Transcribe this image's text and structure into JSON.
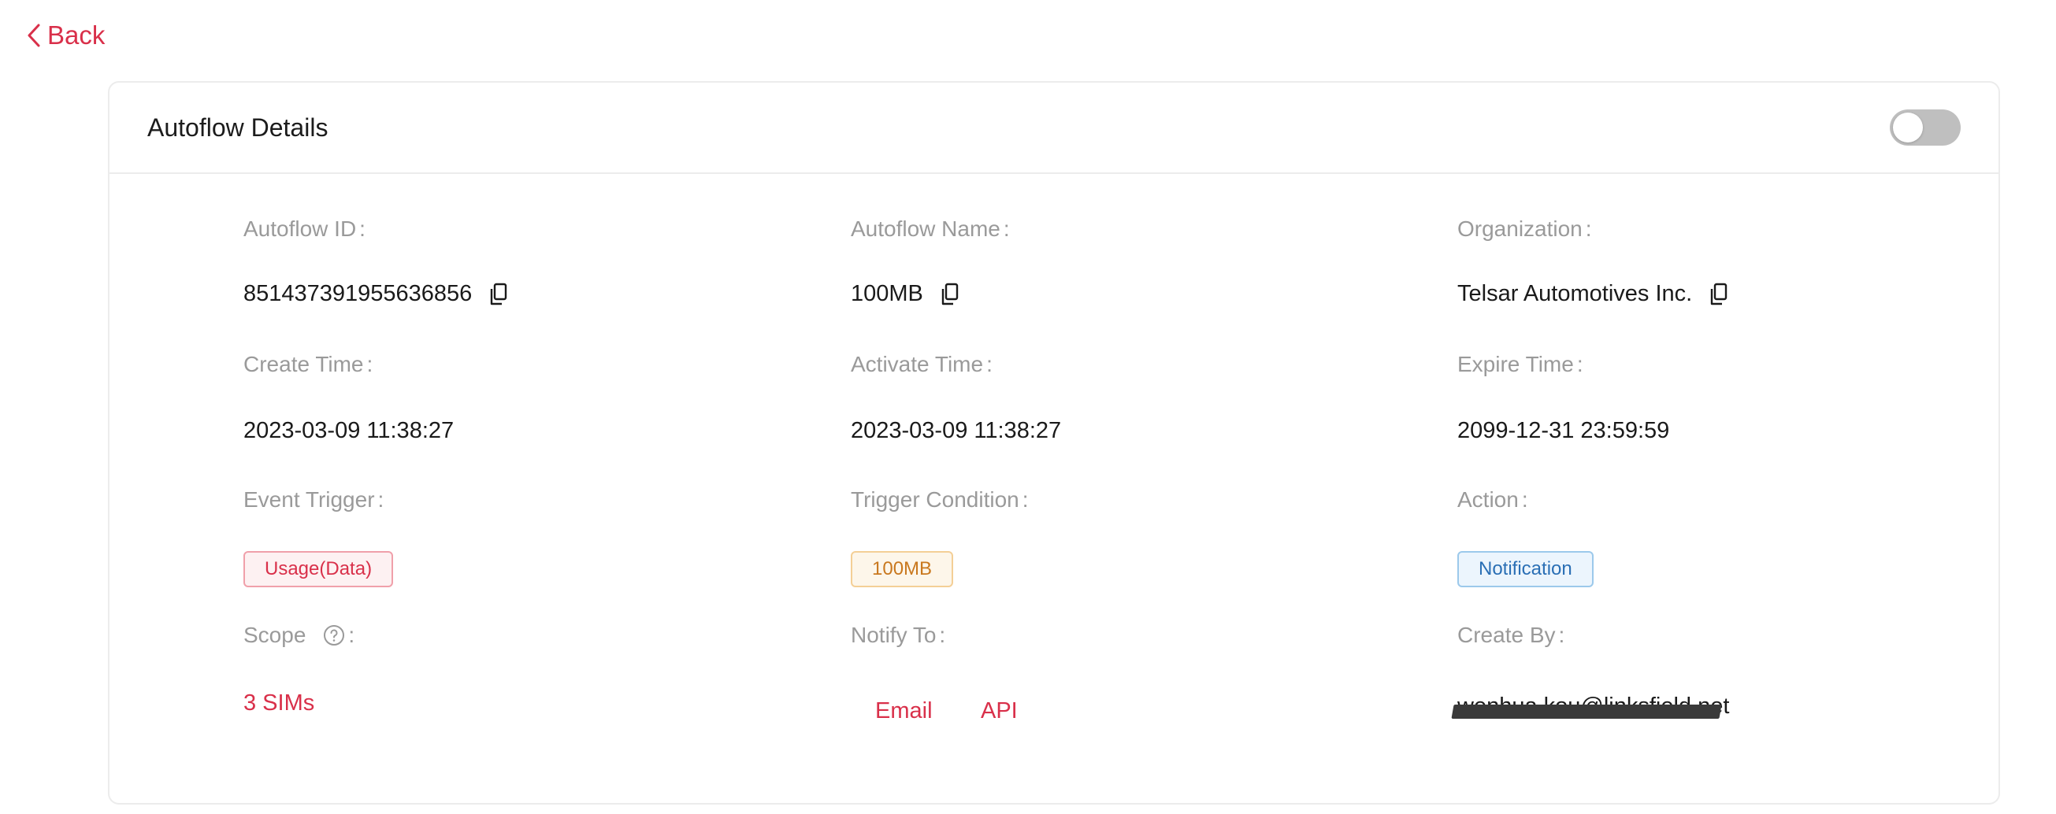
{
  "back": {
    "label": "Back"
  },
  "card": {
    "title": "Autoflow Details"
  },
  "toggle": {
    "state": "off"
  },
  "fields": {
    "autoflow_id": {
      "label": "Autoflow ID",
      "value": "851437391955636856"
    },
    "autoflow_name": {
      "label": "Autoflow Name",
      "value": "100MB"
    },
    "organization": {
      "label": "Organization",
      "value": "Telsar Automotives Inc."
    },
    "create_time": {
      "label": "Create Time",
      "value": "2023-03-09 11:38:27"
    },
    "activate_time": {
      "label": "Activate Time",
      "value": "2023-03-09 11:38:27"
    },
    "expire_time": {
      "label": "Expire Time",
      "value": "2099-12-31 23:59:59"
    },
    "event_trigger": {
      "label": "Event Trigger",
      "value": "Usage(Data)"
    },
    "trigger_condition": {
      "label": "Trigger Condition",
      "value": "100MB"
    },
    "action": {
      "label": "Action",
      "value": "Notification"
    },
    "scope": {
      "label": "Scope",
      "value": "3 SIMs"
    },
    "notify_to": {
      "label": "Notify To",
      "values": [
        "Email",
        "API"
      ]
    },
    "create_by": {
      "label": "Create By",
      "value": "wenhua.kou@linksfield.net"
    }
  },
  "colon": ":",
  "colors": {
    "accent": "#d9304a",
    "label": "#9a9a9a",
    "tag_red": "#d9304a",
    "tag_orange": "#c9781e",
    "tag_blue": "#2a6fb5"
  }
}
